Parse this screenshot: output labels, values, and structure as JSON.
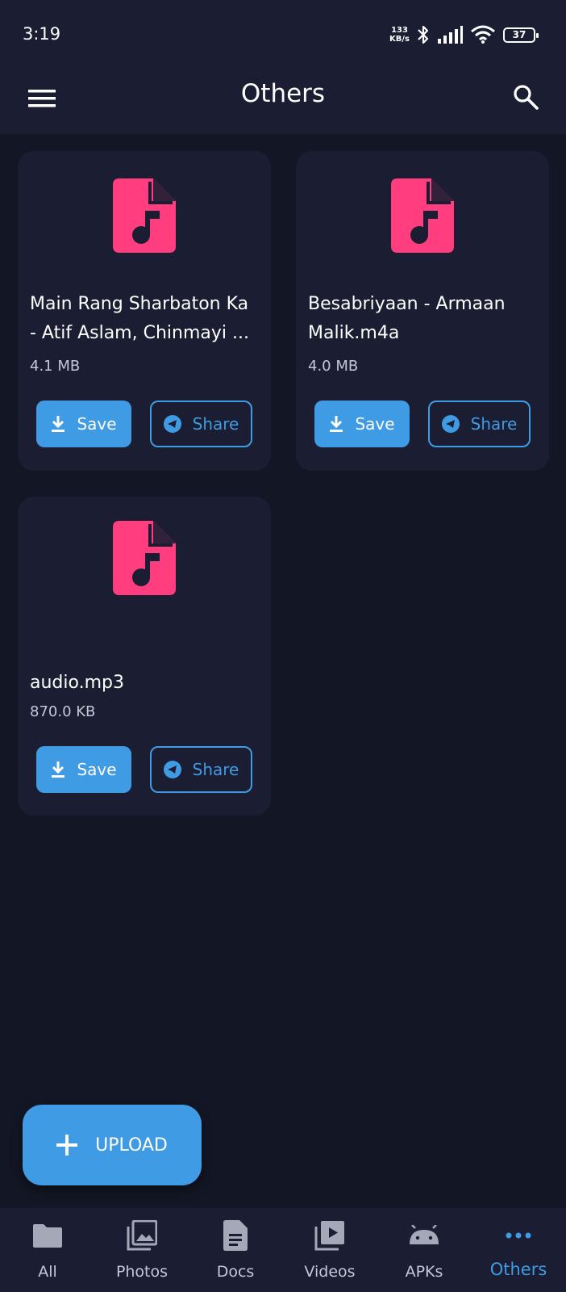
{
  "status_bar": {
    "time": "3:19",
    "net_speed_value": "133",
    "net_speed_unit": "KB/s",
    "battery": "37",
    "icons": [
      "bluetooth-icon",
      "signal-icon",
      "wifi-icon",
      "battery-icon"
    ]
  },
  "app_bar": {
    "title": "Others",
    "menu_icon": "menu-icon",
    "search_icon": "search-icon"
  },
  "files": [
    {
      "name": "Main Rang Sharbaton Ka - Atif Aslam, Chinmayi ...",
      "size": "4.1 MB",
      "icon": "audio-file-icon",
      "save_label": "Save",
      "share_label": "Share"
    },
    {
      "name": "Besabriyaan - Armaan Malik.m4a",
      "size": "4.0 MB",
      "icon": "audio-file-icon",
      "save_label": "Save",
      "share_label": "Share"
    },
    {
      "name": "audio.mp3",
      "size": "870.0 KB",
      "icon": "audio-file-icon",
      "save_label": "Save",
      "share_label": "Share"
    }
  ],
  "upload_button": {
    "label": "UPLOAD",
    "icon": "plus-icon"
  },
  "bottom_nav": {
    "items": [
      {
        "label": "All",
        "icon": "folder-icon"
      },
      {
        "label": "Photos",
        "icon": "photos-icon"
      },
      {
        "label": "Docs",
        "icon": "document-icon"
      },
      {
        "label": "Videos",
        "icon": "video-library-icon"
      },
      {
        "label": "APKs",
        "icon": "android-icon"
      },
      {
        "label": "Others",
        "icon": "more-dots-icon"
      }
    ],
    "active": "Others"
  },
  "colors": {
    "background": "#131624",
    "surface": "#1b1e33",
    "accent": "#3f9be3",
    "file_icon": "#ff3d7f",
    "muted_text": "#c5c7d4"
  }
}
